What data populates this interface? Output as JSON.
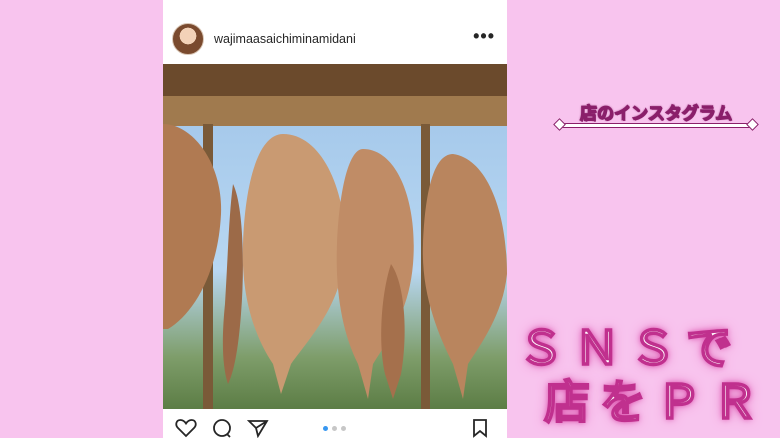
{
  "instagram": {
    "username": "wajimaasaichiminamidani",
    "more_label": "•••",
    "carousel": {
      "count": 3,
      "active": 1
    },
    "icons": [
      "heart-icon",
      "comment-icon",
      "share-icon",
      "bookmark-icon"
    ]
  },
  "overlay": {
    "caption": "店のインスタグラム",
    "headline_line1": "ＳＮＳで",
    "headline_line2": "店をＰＲ"
  },
  "colors": {
    "background": "#f8c4ee",
    "headline_stroke": "#c0308e",
    "caption_stroke": "#8a1f6a",
    "carousel_active": "#3897f0"
  }
}
